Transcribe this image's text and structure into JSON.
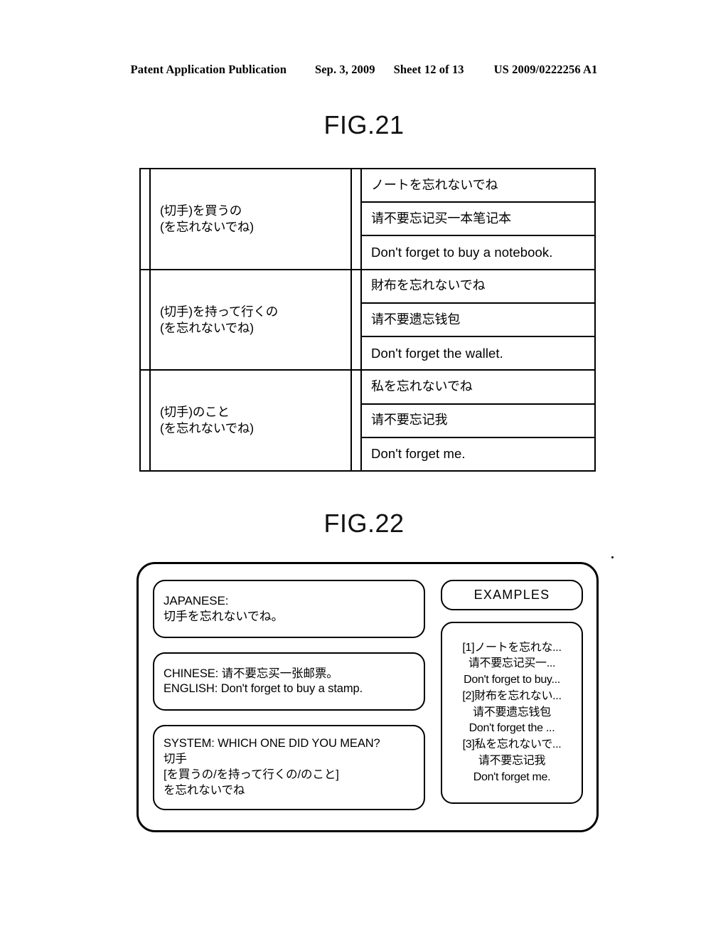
{
  "header": {
    "publication": "Patent Application Publication",
    "date": "Sep. 3, 2009",
    "sheet": "Sheet 12 of 13",
    "doc_number": "US 2009/0222256 A1"
  },
  "figures": {
    "fig21_title": "FIG.21",
    "fig22_title": "FIG.22"
  },
  "fig21": {
    "rows": [
      {
        "pattern": "(切手)を買うの\n(を忘れないでね)",
        "japanese": "ノートを忘れないでね",
        "chinese": "请不要忘记买一本笔记本",
        "english": "Don't forget to buy a notebook."
      },
      {
        "pattern": "(切手)を持って行くの\n(を忘れないでね)",
        "japanese": "財布を忘れないでね",
        "chinese": "请不要遗忘钱包",
        "english": "Don't forget the wallet."
      },
      {
        "pattern": "(切手)のこと\n(を忘れないでね)",
        "japanese": "私を忘れないでね",
        "chinese": "请不要忘记我",
        "english": "Don't forget me."
      }
    ]
  },
  "fig22": {
    "japanese_bubble": "JAPANESE:\n切手を忘れないでね。",
    "translation_bubble": "CHINESE: 请不要忘买一张邮票。\nENGLISH: Don't forget to buy a stamp.",
    "system_bubble": "SYSTEM: WHICH ONE DID YOU MEAN?\n切手\n[を買うの/を持って行くの/のこと]\nを忘れないでね",
    "examples_header": "EXAMPLES",
    "examples_lines": [
      "[1]ノートを忘れな...",
      "请不要忘记买一...",
      "Don't forget to buy...",
      "[2]財布を忘れない...",
      "请不要遗忘钱包",
      "Don't forget the ...",
      "[3]私を忘れないで...",
      "请不要忘记我",
      "Don't forget me."
    ]
  }
}
